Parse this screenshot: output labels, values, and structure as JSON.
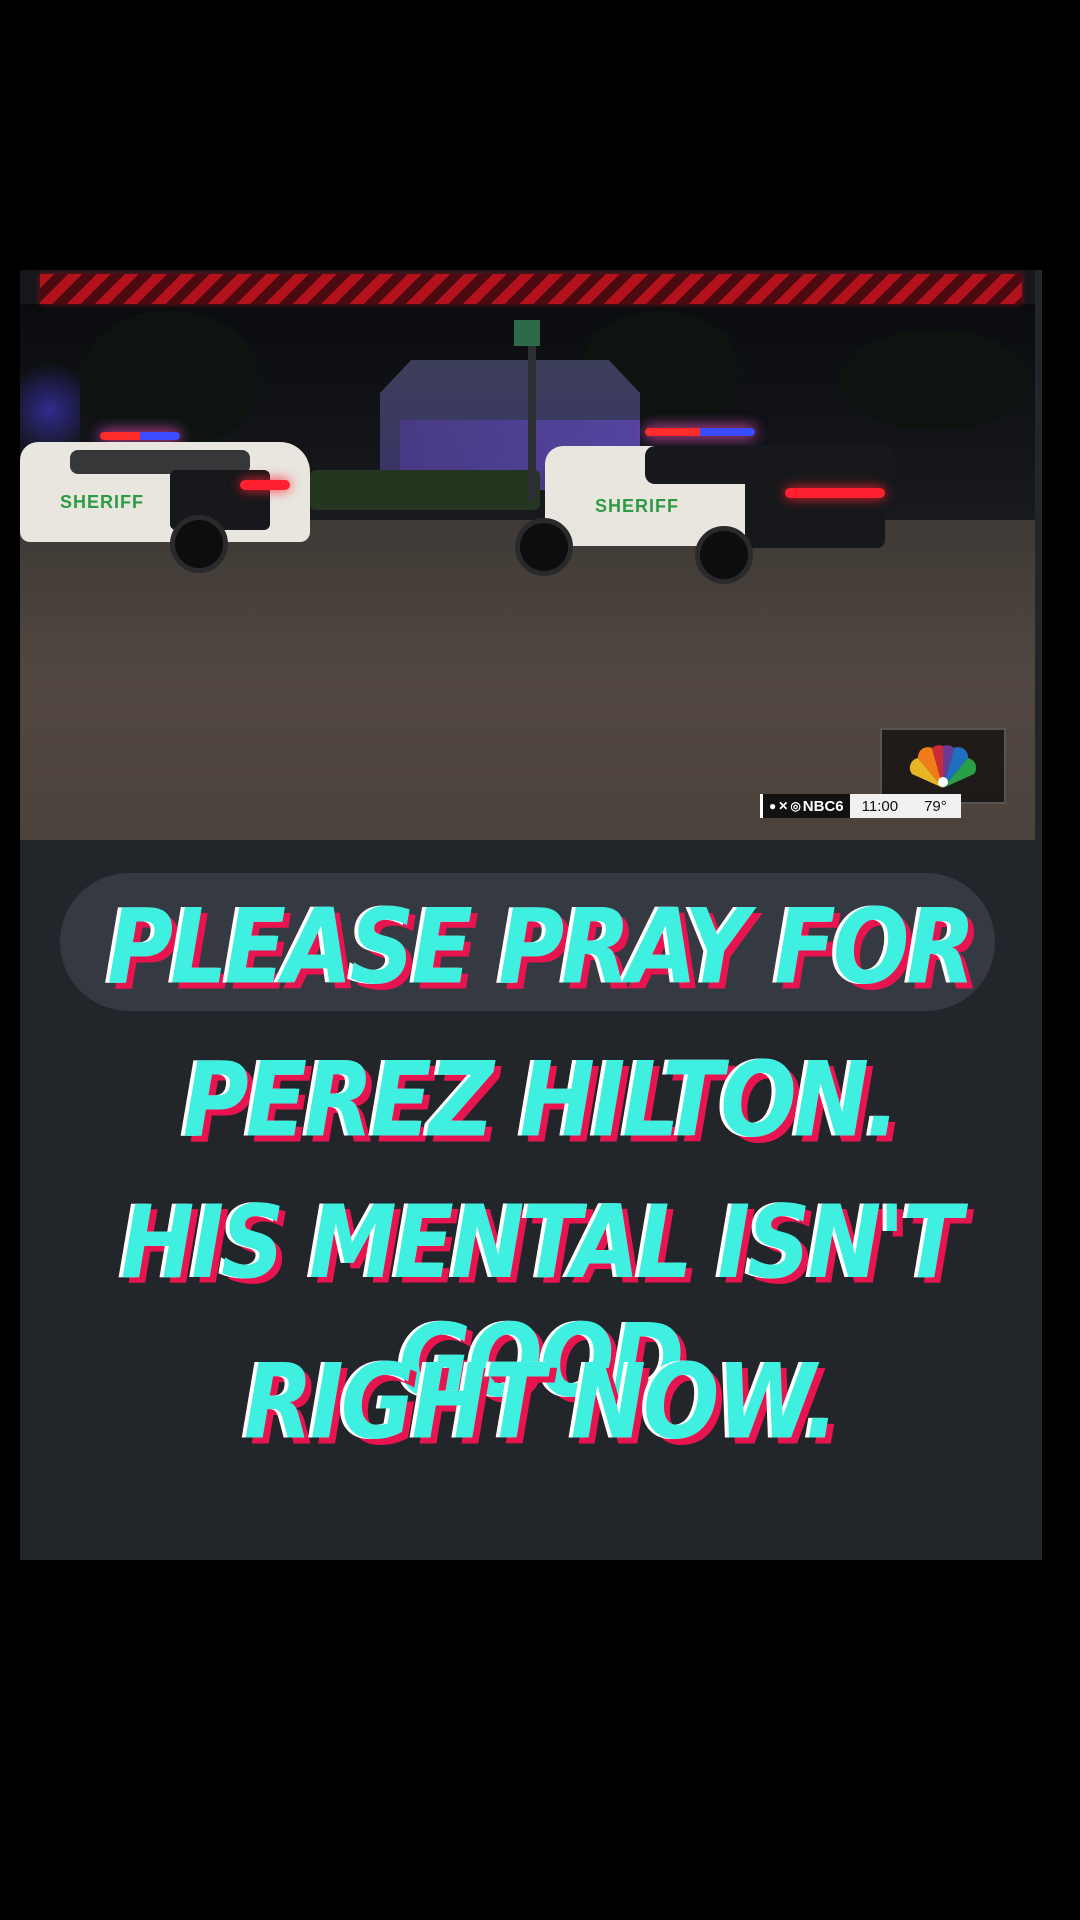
{
  "news_clip": {
    "vehicle_label_left": "SHERIFF",
    "vehicle_label_right": "SHERIFF",
    "ticker": {
      "social_handle": "NBC6",
      "time": "11:00",
      "temperature": "79°"
    },
    "logo": "nbc-peacock-icon"
  },
  "caption": {
    "line1": "PLEASE PRAY FOR",
    "line2": "PEREZ HILTON.",
    "line3": "HIS MENTAL ISN'T GOOD",
    "line4": "RIGHT NOW."
  },
  "colors": {
    "background": "#000000",
    "panel": "#22252a",
    "caption_fill": "#3ff0e1",
    "caption_shadow": "#e8144f",
    "hazard_red": "#b3121c"
  }
}
